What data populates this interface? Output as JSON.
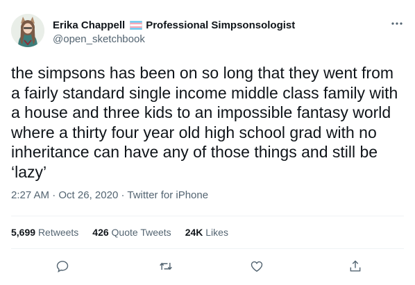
{
  "user": {
    "display_name": "Erika Chappell",
    "title": "Professional Simpsonsologist",
    "handle": "@open_sketchbook",
    "flag_icon": "transgender-flag-emoji"
  },
  "tweet": {
    "text": "the simpsons has been on so long that they went from\na fairly standard single income middle class family with\na house and three kids to an impossible fantasy world\nwhere a thirty four year old high school grad with no\ninheritance can have any of those things and still be\n‘lazy’",
    "time": "2:27 AM",
    "date": "Oct 26, 2020",
    "source": "Twitter for iPhone",
    "separator": " · "
  },
  "stats": {
    "retweets_count": "5,699",
    "retweets_label": "Retweets",
    "quotes_count": "426",
    "quotes_label": "Quote Tweets",
    "likes_count": "24K",
    "likes_label": "Likes"
  },
  "actions": {
    "reply_icon": "reply-icon",
    "retweet_icon": "retweet-icon",
    "like_icon": "heart-icon",
    "share_icon": "share-icon"
  },
  "colors": {
    "text": "#0f1419",
    "secondary": "#536471",
    "divider": "#eff3f4",
    "flag_blue": "#5bcefa",
    "flag_pink": "#f5a9b8"
  }
}
